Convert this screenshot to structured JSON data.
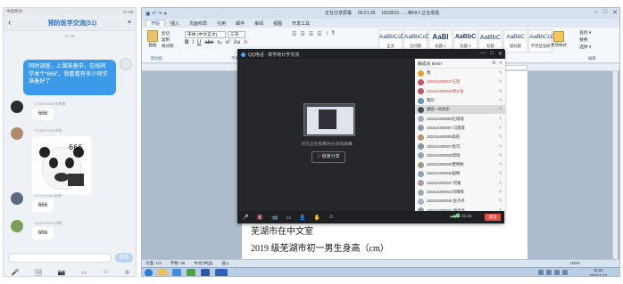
{
  "phone": {
    "status_left": "中国移动",
    "status_right": "17:48",
    "back": "‹",
    "title": "预防医学交流(51)",
    "menu": "≡",
    "time": "12:45",
    "my_message": "同时调查，上课准备中，在线同学发个“666”，我看看有多少同学准备好了",
    "messages": [
      {
        "name": "1715070036 张博楠",
        "text": "666",
        "avatar_color": "#2b2b2b"
      },
      {
        "name": "1715070035 佘铁",
        "text": "666",
        "avatar_color": "#b08a6e"
      },
      {
        "name": "1715070060 赵新",
        "text": "666",
        "avatar_color": "#5b6a80"
      },
      {
        "name": "1715070019 刘畅",
        "text": "666",
        "avatar_color": "#7aa05a"
      }
    ],
    "sticker_text": "666",
    "send": "发送",
    "bar_icons": [
      "🎤",
      "🖼",
      "📷",
      "▭",
      "☺",
      "⊕"
    ]
  },
  "word": {
    "quick_access": "▣ ↶ ↷ ▾",
    "share_status": "正在分享屏幕",
    "share_time": "00:21:26",
    "share_viewers": "1810510……等59人正在观看",
    "tabs": [
      "开始",
      "插入",
      "页面布局",
      "引用",
      "邮件",
      "审阅",
      "视图",
      "开发工具"
    ],
    "active_tab": "开始",
    "paste": "粘贴",
    "clipboard_items": [
      "剪切",
      "复制",
      "格式刷"
    ],
    "font_name": "宋体 (中文正文)",
    "font_size": "三号",
    "format_buttons": [
      "B",
      "I",
      "U",
      "abe",
      "x₂",
      "x²",
      "Aa",
      "A"
    ],
    "para_buttons": [
      "☰",
      "☰",
      "☰",
      "☰",
      "↕",
      "¶"
    ],
    "styles": [
      {
        "preview": "AaBbCcDd",
        "label": "正文"
      },
      {
        "preview": "AaBbCcDd",
        "label": "无间隔"
      },
      {
        "preview": "AaBl",
        "label": "标题 1"
      },
      {
        "preview": "AaBbC",
        "label": "标题 2"
      },
      {
        "preview": "AaBbC",
        "label": "标题"
      },
      {
        "preview": "AaBbC",
        "label": "副标题"
      },
      {
        "preview": "AaBbCcDd",
        "label": "不明显强调"
      }
    ],
    "change_styles": "更改样式",
    "edit_items": [
      "查找 ▾",
      "替换",
      "选择 ▾"
    ],
    "groups": [
      "剪贴板",
      "字体",
      "段落",
      "样式",
      "编辑"
    ],
    "doc_line1": "芜湖市在中文室",
    "doc_line2": "2019 级芜湖市初一男生身高（cm）",
    "status_page": "页面: 1/3",
    "status_words": "字数: 96",
    "status_lang": "中文(中国)",
    "status_mode": "插入",
    "zoom": "100%",
    "clock_time": "14:22",
    "clock_date": "2020-2-23"
  },
  "qq": {
    "title": "QQ电话 · 数学统计学交流",
    "controls": [
      "—",
      "□",
      "✕"
    ],
    "sharing_text": "对方正在观看你分享的屏幕",
    "stop_label": "结束分享",
    "stop_icon": "⏻",
    "bottom_icons": [
      "🎤",
      "🔇",
      "📹",
      "▭",
      "👤",
      "✋",
      "☺"
    ],
    "signal": "▂▄▆",
    "time": "21:31",
    "exit": "退出",
    "list_header": "群成员 60/67",
    "list_icons": [
      "⚙",
      "✕"
    ],
    "members": [
      {
        "name": "我",
        "color": "#e0a23a",
        "style": "normal"
      },
      {
        "name": "181010400017王茜",
        "color": "#c2556b",
        "style": "red"
      },
      {
        "name": "181010400034郭沙金",
        "color": "#c2556b",
        "style": "red"
      },
      {
        "name": "我的",
        "color": "#6f8fb5",
        "style": "normal"
      },
      {
        "name": "播客一同快乐",
        "color": "#444c57",
        "style": "hl"
      },
      {
        "name": "181010400006杜瑞瑞",
        "color": "#a3b0c0",
        "style": "normal"
      },
      {
        "name": "181010400007 冯蓉蓉",
        "color": "#8e9bb0",
        "style": "normal"
      },
      {
        "name": "181010400009高航",
        "color": "#b5937a",
        "style": "normal"
      },
      {
        "name": "181010400027张可",
        "color": "#7e95ad",
        "style": "normal"
      },
      {
        "name": "181010400035郭瑞",
        "color": "#96a6b8",
        "style": "normal"
      },
      {
        "name": "181010400030樊畅畅",
        "color": "#a09a8a",
        "style": "normal"
      },
      {
        "name": "181010400036田畅",
        "color": "#8da2b6",
        "style": "normal"
      },
      {
        "name": "181010400037 何嘉",
        "color": "#b09aa0",
        "style": "normal"
      },
      {
        "name": "181010400044刘晴晴",
        "color": "#9aaabb",
        "style": "normal"
      },
      {
        "name": "181010400045 彭丹丹",
        "color": "#a8b4c2",
        "style": "normal"
      },
      {
        "name": "181010400041 谢晶晶",
        "color": "#8897a8",
        "style": "normal"
      },
      {
        "name": "181010400050蒋文文",
        "color": "#a39585",
        "style": "normal"
      }
    ]
  }
}
